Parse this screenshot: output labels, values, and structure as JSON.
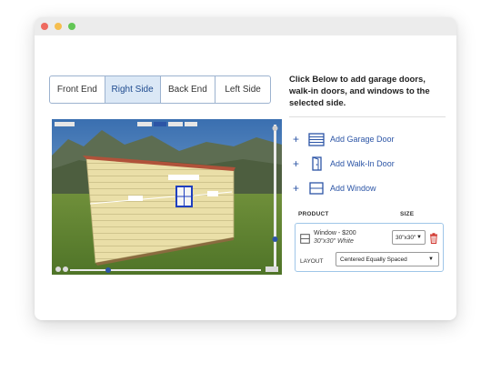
{
  "tabs": [
    {
      "label": "Front End",
      "active": false
    },
    {
      "label": "Right Side",
      "active": true
    },
    {
      "label": "Back End",
      "active": false
    },
    {
      "label": "Left Side",
      "active": false
    }
  ],
  "instructions": "Click Below to add garage doors, walk-in doors, and windows to the selected side.",
  "add_items": [
    {
      "label": "Add Garage Door",
      "icon": "garage-door-icon"
    },
    {
      "label": "Add Walk-In Door",
      "icon": "walk-in-door-icon"
    },
    {
      "label": "Add Window",
      "icon": "window-icon"
    }
  ],
  "table": {
    "col_product": "PRODUCT",
    "col_size": "SIZE",
    "item": {
      "name": "Window - $200",
      "detail": "30\"x30\" White",
      "size": "30\"x30\"",
      "layout_label": "LAYOUT",
      "layout_value": "Centered Equally Spaced"
    }
  },
  "colors": {
    "accent": "#2c55a6",
    "tab_active_bg": "#dbe8f6",
    "trash": "#d0342c",
    "box_border": "#9fc6e8"
  }
}
